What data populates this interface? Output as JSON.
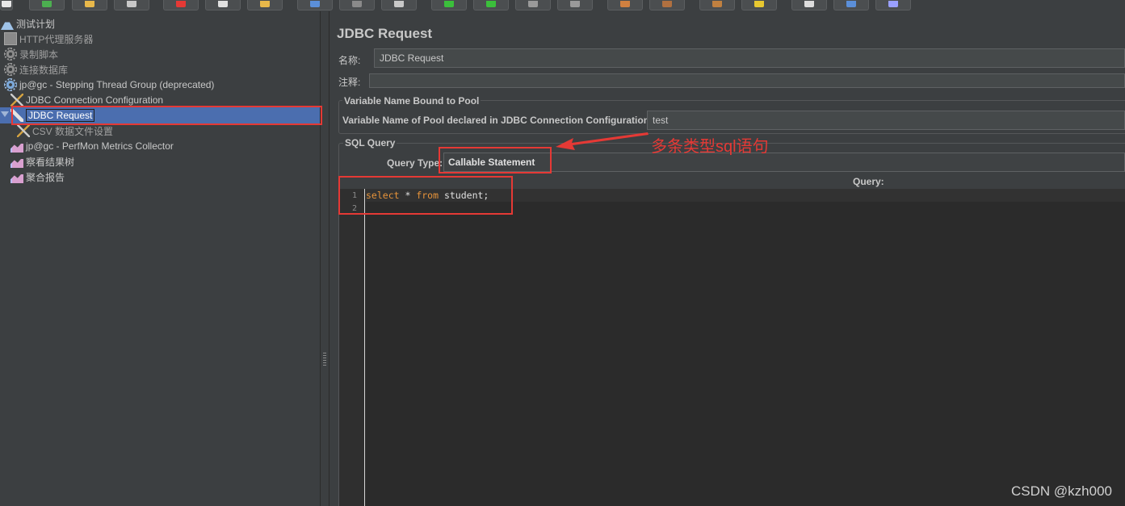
{
  "toolbar": {
    "buttons": [
      {
        "name": "new-icon",
        "color": "#e8e8e8"
      },
      {
        "name": "templates-icon",
        "color": "#4caf50"
      },
      {
        "name": "open-icon",
        "color": "#e8b84a"
      },
      {
        "name": "save-icon",
        "color": "#c8c8c8"
      },
      {
        "name": "cut-icon",
        "color": "#e53935"
      },
      {
        "name": "copy-icon",
        "color": "#e0e0e0"
      },
      {
        "name": "paste-icon",
        "color": "#e8b84a"
      },
      {
        "name": "expand-icon",
        "color": "#5b8fd9"
      },
      {
        "name": "collapse-icon",
        "color": "#8a8a8a"
      },
      {
        "name": "toggle-icon",
        "color": "#c8c8c8"
      },
      {
        "name": "start-icon",
        "color": "#3bbf3b"
      },
      {
        "name": "start-no-pause-icon",
        "color": "#3bbf3b"
      },
      {
        "name": "stop-icon",
        "color": "#9a9a9a"
      },
      {
        "name": "shutdown-icon",
        "color": "#9a9a9a"
      },
      {
        "name": "clear-icon",
        "color": "#d08040"
      },
      {
        "name": "clear-all-icon",
        "color": "#b07040"
      },
      {
        "name": "search-icon",
        "color": "#c08040"
      },
      {
        "name": "reset-search-icon",
        "color": "#e8c830"
      },
      {
        "name": "function-helper-icon",
        "color": "#dddddd"
      },
      {
        "name": "help-icon",
        "color": "#5b8fd9"
      },
      {
        "name": "remote-icon",
        "color": "#9aa0ff"
      }
    ]
  },
  "tree": {
    "items": [
      {
        "label": "测试计划",
        "icon": "flask-icon"
      },
      {
        "label": "HTTP代理服务器",
        "icon": "proxy-icon"
      },
      {
        "label": "录制脚本",
        "icon": "gear-icon"
      },
      {
        "label": "连接数据库",
        "icon": "gear-icon"
      },
      {
        "label": "jp@gc - Stepping Thread Group (deprecated)",
        "icon": "thread-group-icon"
      },
      {
        "label": "JDBC Connection Configuration",
        "icon": "config-tools-icon"
      },
      {
        "label": "JDBC Request",
        "icon": "sampler-pen-icon"
      },
      {
        "label": "CSV 数据文件设置",
        "icon": "config-tools-icon"
      },
      {
        "label": "jp@gc - PerfMon Metrics Collector",
        "icon": "listener-chart-icon"
      },
      {
        "label": "察看结果树",
        "icon": "listener-chart-icon"
      },
      {
        "label": "聚合报告",
        "icon": "listener-chart-icon"
      }
    ]
  },
  "panel": {
    "title": "JDBC Request",
    "name_label": "名称:",
    "name_value": "JDBC Request",
    "comment_label": "注释:",
    "comment_value": "",
    "pool_group_title": "Variable Name Bound to Pool",
    "pool_label": "Variable Name of Pool declared in JDBC Connection Configuration:",
    "pool_value": "test",
    "sql_group_title": "SQL Query",
    "query_type_label": "Query Type:",
    "query_type_value": "Callable Statement",
    "query_label": "Query:",
    "editor": {
      "lines": [
        {
          "no": "1",
          "kw1": "select",
          "mid": " * ",
          "kw2": "from",
          "rest": " student;"
        },
        {
          "no": "2",
          "kw1": "",
          "mid": "",
          "kw2": "",
          "rest": ""
        }
      ]
    }
  },
  "annotation": {
    "text": "多条类型sql语句",
    "color": "#e53935"
  },
  "watermark": "CSDN @kzh000"
}
